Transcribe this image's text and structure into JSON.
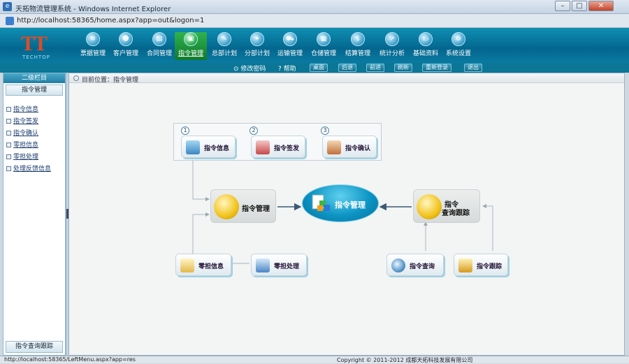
{
  "window": {
    "title": "天拓物流管理系统 - Windows Internet Explorer",
    "address": "http://localhost:58365/home.aspx?app=out&logon=1",
    "min_label": "–",
    "max_label": "□",
    "close_label": "✕"
  },
  "logo": {
    "mark": "TT",
    "text": "TECHTOP"
  },
  "nav": [
    {
      "label": "票据管理",
      "icon": "gear-icon",
      "glyph": "✲"
    },
    {
      "label": "客户管理",
      "icon": "user-icon",
      "glyph": "☻"
    },
    {
      "label": "合同管理",
      "icon": "document-icon",
      "glyph": "▤"
    },
    {
      "label": "指令管理",
      "icon": "clipboard-icon",
      "glyph": "▣"
    },
    {
      "label": "总部计划",
      "icon": "pencil-icon",
      "glyph": "✎"
    },
    {
      "label": "分部计划",
      "icon": "compass-icon",
      "glyph": "✦"
    },
    {
      "label": "运输管理",
      "icon": "truck-icon",
      "glyph": "⛟"
    },
    {
      "label": "仓储管理",
      "icon": "box-icon",
      "glyph": "▦"
    },
    {
      "label": "结算管理",
      "icon": "dollar-icon",
      "glyph": "$"
    },
    {
      "label": "统计分析",
      "icon": "chart-icon",
      "glyph": "↗"
    },
    {
      "label": "基础资料",
      "icon": "folder-icon",
      "glyph": "▭"
    },
    {
      "label": "系统设置",
      "icon": "settings-icon",
      "glyph": "⚙"
    }
  ],
  "toolbar": {
    "change_password": "修改密码",
    "help": "帮助",
    "buttons": [
      "桌面",
      "后退",
      "前进",
      "刷新",
      "重新登录",
      "退出"
    ]
  },
  "sidebar": {
    "header": "二级栏目",
    "section": "指令管理",
    "items": [
      "指令信息",
      "指令签发",
      "指令确认",
      "零担信息",
      "零担处理",
      "处理反馈信息"
    ],
    "bottom": "指令查询跟踪"
  },
  "breadcrumb": "目前位置：指令管理",
  "flow": {
    "steps": [
      "1",
      "2",
      "3"
    ],
    "top_nodes": [
      "指令信息",
      "指令签发",
      "指令确认"
    ],
    "manage_node": "指令管理",
    "center": "指令管理",
    "query_node_line1": "指令",
    "query_node_line2": "查询跟踪",
    "bottom_left": [
      "零担信息",
      "零担处理"
    ],
    "bottom_right": [
      "指令查询",
      "指令跟踪"
    ]
  },
  "status": {
    "url": "http://localhost:58365/LeftMenu.aspx?app=res",
    "copyright": "Copyright © 2011-2012 成都天拓科技发展有限公司"
  }
}
